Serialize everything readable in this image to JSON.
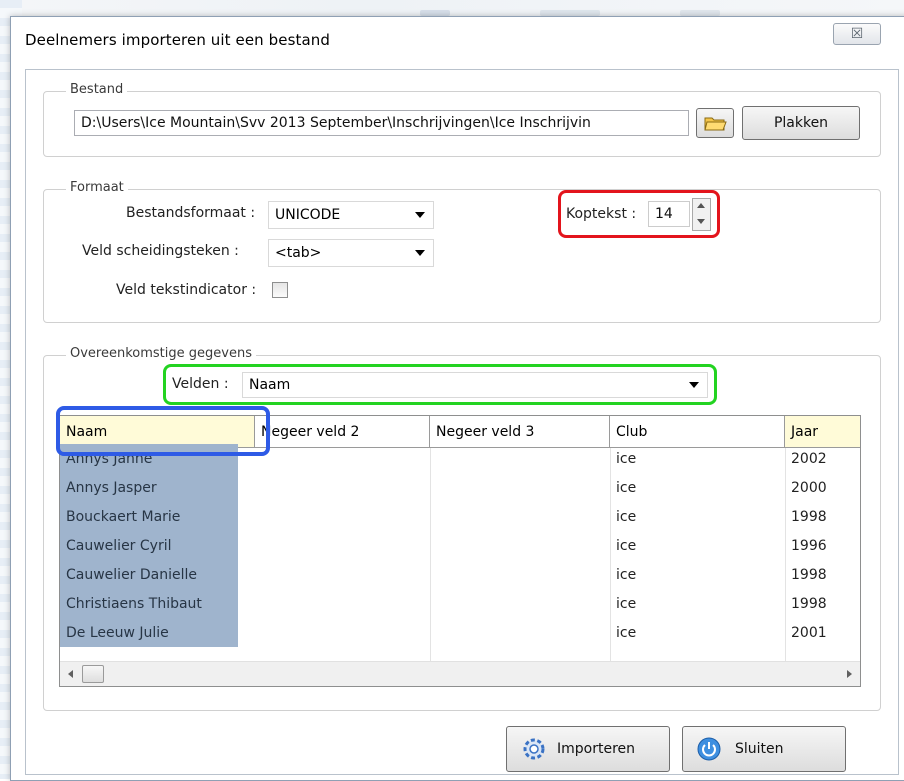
{
  "window": {
    "title": "Deelnemers importeren uit een bestand",
    "close_glyph": "☒"
  },
  "bestand": {
    "legend": "Bestand",
    "path": "D:\\Users\\Ice Mountain\\Svv 2013 September\\Inschrijvingen\\Ice Inschrijvin",
    "browse_icon": "folder-icon",
    "paste_label": "Plakken"
  },
  "formaat": {
    "legend": "Formaat",
    "file_format_label": "Bestandsformaat :",
    "file_format_value": "UNICODE",
    "separator_label": "Veld scheidingsteken :",
    "separator_value": "<tab>",
    "text_indicator_label": "Veld tekstindicator :",
    "text_indicator_checked": false,
    "header_label": "Koptekst :",
    "header_value": "14"
  },
  "mapping": {
    "legend": "Overeenkomstige gegevens",
    "fields_label": "Velden :",
    "fields_value": "Naam"
  },
  "grid": {
    "columns": [
      "Naam",
      "Negeer veld 2",
      "Negeer veld 3",
      "Club",
      "Jaar"
    ],
    "rows": [
      [
        "Annys Janne",
        "",
        "",
        "ice",
        "2002"
      ],
      [
        "Annys Jasper",
        "",
        "",
        "ice",
        "2000"
      ],
      [
        "Bouckaert Marie",
        "",
        "",
        "ice",
        "1998"
      ],
      [
        "Cauwelier Cyril",
        "",
        "",
        "ice",
        "1996"
      ],
      [
        "Cauwelier Danielle",
        "",
        "",
        "ice",
        "1998"
      ],
      [
        "Christiaens Thibaut",
        "",
        "",
        "ice",
        "1998"
      ],
      [
        "De Leeuw Julie",
        "",
        "",
        "ice",
        "2001"
      ]
    ]
  },
  "buttons": {
    "import_label": "Importeren",
    "close_label": "Sluiten"
  },
  "colors": {
    "red_highlight": "#e3141c",
    "green_highlight": "#23d321",
    "blue_highlight": "#2e5be6",
    "selection": "#9fb4cd"
  }
}
